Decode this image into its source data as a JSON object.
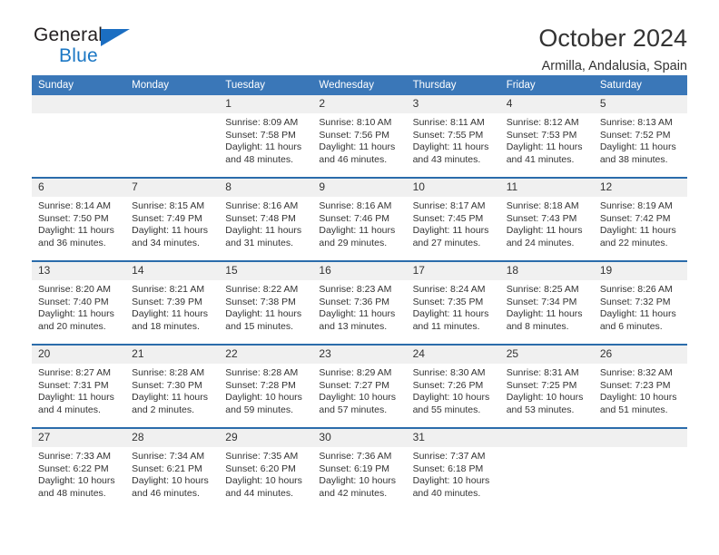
{
  "brand": {
    "name_part1": "General",
    "name_part2": "Blue",
    "triangle_color": "#1b6ec2",
    "blue_color": "#1b77c4"
  },
  "header": {
    "title": "October 2024",
    "location": "Armilla, Andalusia, Spain"
  },
  "theme": {
    "header_blue": "#3a77b8",
    "row_line_blue": "#2b6cab",
    "daynum_bg": "#f0f0f0",
    "text": "#333333"
  },
  "weekday_headers": [
    "Sunday",
    "Monday",
    "Tuesday",
    "Wednesday",
    "Thursday",
    "Friday",
    "Saturday"
  ],
  "labels": {
    "sunrise_prefix": "Sunrise:",
    "sunset_prefix": "Sunset:",
    "daylight_prefix": "Daylight:"
  },
  "weeks": [
    [
      {
        "day": "",
        "sunrise": "",
        "sunset": "",
        "daylight_line1": "",
        "daylight_line2": "",
        "empty": true
      },
      {
        "day": "",
        "sunrise": "",
        "sunset": "",
        "daylight_line1": "",
        "daylight_line2": "",
        "empty": true
      },
      {
        "day": "1",
        "sunrise": "Sunrise: 8:09 AM",
        "sunset": "Sunset: 7:58 PM",
        "daylight_line1": "Daylight: 11 hours",
        "daylight_line2": "and 48 minutes."
      },
      {
        "day": "2",
        "sunrise": "Sunrise: 8:10 AM",
        "sunset": "Sunset: 7:56 PM",
        "daylight_line1": "Daylight: 11 hours",
        "daylight_line2": "and 46 minutes."
      },
      {
        "day": "3",
        "sunrise": "Sunrise: 8:11 AM",
        "sunset": "Sunset: 7:55 PM",
        "daylight_line1": "Daylight: 11 hours",
        "daylight_line2": "and 43 minutes."
      },
      {
        "day": "4",
        "sunrise": "Sunrise: 8:12 AM",
        "sunset": "Sunset: 7:53 PM",
        "daylight_line1": "Daylight: 11 hours",
        "daylight_line2": "and 41 minutes."
      },
      {
        "day": "5",
        "sunrise": "Sunrise: 8:13 AM",
        "sunset": "Sunset: 7:52 PM",
        "daylight_line1": "Daylight: 11 hours",
        "daylight_line2": "and 38 minutes."
      }
    ],
    [
      {
        "day": "6",
        "sunrise": "Sunrise: 8:14 AM",
        "sunset": "Sunset: 7:50 PM",
        "daylight_line1": "Daylight: 11 hours",
        "daylight_line2": "and 36 minutes."
      },
      {
        "day": "7",
        "sunrise": "Sunrise: 8:15 AM",
        "sunset": "Sunset: 7:49 PM",
        "daylight_line1": "Daylight: 11 hours",
        "daylight_line2": "and 34 minutes."
      },
      {
        "day": "8",
        "sunrise": "Sunrise: 8:16 AM",
        "sunset": "Sunset: 7:48 PM",
        "daylight_line1": "Daylight: 11 hours",
        "daylight_line2": "and 31 minutes."
      },
      {
        "day": "9",
        "sunrise": "Sunrise: 8:16 AM",
        "sunset": "Sunset: 7:46 PM",
        "daylight_line1": "Daylight: 11 hours",
        "daylight_line2": "and 29 minutes."
      },
      {
        "day": "10",
        "sunrise": "Sunrise: 8:17 AM",
        "sunset": "Sunset: 7:45 PM",
        "daylight_line1": "Daylight: 11 hours",
        "daylight_line2": "and 27 minutes."
      },
      {
        "day": "11",
        "sunrise": "Sunrise: 8:18 AM",
        "sunset": "Sunset: 7:43 PM",
        "daylight_line1": "Daylight: 11 hours",
        "daylight_line2": "and 24 minutes."
      },
      {
        "day": "12",
        "sunrise": "Sunrise: 8:19 AM",
        "sunset": "Sunset: 7:42 PM",
        "daylight_line1": "Daylight: 11 hours",
        "daylight_line2": "and 22 minutes."
      }
    ],
    [
      {
        "day": "13",
        "sunrise": "Sunrise: 8:20 AM",
        "sunset": "Sunset: 7:40 PM",
        "daylight_line1": "Daylight: 11 hours",
        "daylight_line2": "and 20 minutes."
      },
      {
        "day": "14",
        "sunrise": "Sunrise: 8:21 AM",
        "sunset": "Sunset: 7:39 PM",
        "daylight_line1": "Daylight: 11 hours",
        "daylight_line2": "and 18 minutes."
      },
      {
        "day": "15",
        "sunrise": "Sunrise: 8:22 AM",
        "sunset": "Sunset: 7:38 PM",
        "daylight_line1": "Daylight: 11 hours",
        "daylight_line2": "and 15 minutes."
      },
      {
        "day": "16",
        "sunrise": "Sunrise: 8:23 AM",
        "sunset": "Sunset: 7:36 PM",
        "daylight_line1": "Daylight: 11 hours",
        "daylight_line2": "and 13 minutes."
      },
      {
        "day": "17",
        "sunrise": "Sunrise: 8:24 AM",
        "sunset": "Sunset: 7:35 PM",
        "daylight_line1": "Daylight: 11 hours",
        "daylight_line2": "and 11 minutes."
      },
      {
        "day": "18",
        "sunrise": "Sunrise: 8:25 AM",
        "sunset": "Sunset: 7:34 PM",
        "daylight_line1": "Daylight: 11 hours",
        "daylight_line2": "and 8 minutes."
      },
      {
        "day": "19",
        "sunrise": "Sunrise: 8:26 AM",
        "sunset": "Sunset: 7:32 PM",
        "daylight_line1": "Daylight: 11 hours",
        "daylight_line2": "and 6 minutes."
      }
    ],
    [
      {
        "day": "20",
        "sunrise": "Sunrise: 8:27 AM",
        "sunset": "Sunset: 7:31 PM",
        "daylight_line1": "Daylight: 11 hours",
        "daylight_line2": "and 4 minutes."
      },
      {
        "day": "21",
        "sunrise": "Sunrise: 8:28 AM",
        "sunset": "Sunset: 7:30 PM",
        "daylight_line1": "Daylight: 11 hours",
        "daylight_line2": "and 2 minutes."
      },
      {
        "day": "22",
        "sunrise": "Sunrise: 8:28 AM",
        "sunset": "Sunset: 7:28 PM",
        "daylight_line1": "Daylight: 10 hours",
        "daylight_line2": "and 59 minutes."
      },
      {
        "day": "23",
        "sunrise": "Sunrise: 8:29 AM",
        "sunset": "Sunset: 7:27 PM",
        "daylight_line1": "Daylight: 10 hours",
        "daylight_line2": "and 57 minutes."
      },
      {
        "day": "24",
        "sunrise": "Sunrise: 8:30 AM",
        "sunset": "Sunset: 7:26 PM",
        "daylight_line1": "Daylight: 10 hours",
        "daylight_line2": "and 55 minutes."
      },
      {
        "day": "25",
        "sunrise": "Sunrise: 8:31 AM",
        "sunset": "Sunset: 7:25 PM",
        "daylight_line1": "Daylight: 10 hours",
        "daylight_line2": "and 53 minutes."
      },
      {
        "day": "26",
        "sunrise": "Sunrise: 8:32 AM",
        "sunset": "Sunset: 7:23 PM",
        "daylight_line1": "Daylight: 10 hours",
        "daylight_line2": "and 51 minutes."
      }
    ],
    [
      {
        "day": "27",
        "sunrise": "Sunrise: 7:33 AM",
        "sunset": "Sunset: 6:22 PM",
        "daylight_line1": "Daylight: 10 hours",
        "daylight_line2": "and 48 minutes."
      },
      {
        "day": "28",
        "sunrise": "Sunrise: 7:34 AM",
        "sunset": "Sunset: 6:21 PM",
        "daylight_line1": "Daylight: 10 hours",
        "daylight_line2": "and 46 minutes."
      },
      {
        "day": "29",
        "sunrise": "Sunrise: 7:35 AM",
        "sunset": "Sunset: 6:20 PM",
        "daylight_line1": "Daylight: 10 hours",
        "daylight_line2": "and 44 minutes."
      },
      {
        "day": "30",
        "sunrise": "Sunrise: 7:36 AM",
        "sunset": "Sunset: 6:19 PM",
        "daylight_line1": "Daylight: 10 hours",
        "daylight_line2": "and 42 minutes."
      },
      {
        "day": "31",
        "sunrise": "Sunrise: 7:37 AM",
        "sunset": "Sunset: 6:18 PM",
        "daylight_line1": "Daylight: 10 hours",
        "daylight_line2": "and 40 minutes."
      },
      {
        "day": "",
        "sunrise": "",
        "sunset": "",
        "daylight_line1": "",
        "daylight_line2": "",
        "empty": true
      },
      {
        "day": "",
        "sunrise": "",
        "sunset": "",
        "daylight_line1": "",
        "daylight_line2": "",
        "empty": true
      }
    ]
  ]
}
